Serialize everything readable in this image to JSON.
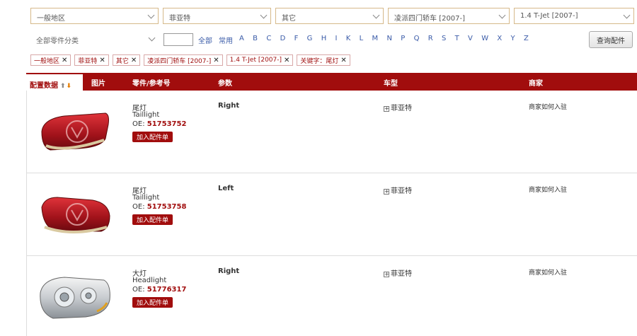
{
  "filters": {
    "region": "一般地区",
    "brand": "菲亚特",
    "series": "其它",
    "model": "凌派四门轿车 [2007-]",
    "engine": "1.4 T-Jet [2007-]"
  },
  "toolbar": {
    "category": "全部零件分类",
    "alpha_input_value": "",
    "alpha_links": [
      "全部",
      "常用",
      "A",
      "B",
      "C",
      "D",
      "F",
      "G",
      "H",
      "I",
      "K",
      "L",
      "M",
      "N",
      "P",
      "Q",
      "R",
      "S",
      "T",
      "V",
      "W",
      "X",
      "Y",
      "Z"
    ],
    "search_label": "查询配件"
  },
  "chips": [
    {
      "label": "一般地区"
    },
    {
      "label": "菲亚特"
    },
    {
      "label": "其它"
    },
    {
      "label": "凌派四门轿车 [2007-]"
    },
    {
      "label": "1.4 T-Jet [2007-]"
    },
    {
      "label": "关键字：尾灯"
    }
  ],
  "table": {
    "tab_active": "配置数据",
    "headers": {
      "image": "图片",
      "part": "零件/参考号",
      "params": "参数",
      "model": "车型",
      "vendor": "商家"
    }
  },
  "items": [
    {
      "name_cn": "尾灯",
      "name_en": "Taillight",
      "oe_prefix": "OE: ",
      "oe": "51753752",
      "add_label": "加入配件单",
      "param": "Right",
      "model": "菲亚特",
      "vendor": "商家如何入驻",
      "thumb_icon": "taillight-image"
    },
    {
      "name_cn": "尾灯",
      "name_en": "Taillight",
      "oe_prefix": "OE: ",
      "oe": "51753758",
      "add_label": "加入配件单",
      "param": "Left",
      "model": "菲亚特",
      "vendor": "商家如何入驻",
      "thumb_icon": "taillight-image"
    },
    {
      "name_cn": "大灯",
      "name_en": "Headlight",
      "oe_prefix": "OE: ",
      "oe": "51776317",
      "add_label": "加入配件单",
      "param": "Right",
      "model": "菲亚特",
      "vendor": "商家如何入驻",
      "thumb_icon": "headlight-image"
    }
  ],
  "colors": {
    "accent": "#a10d0d",
    "link": "#3a5ba8",
    "sort_active": "#e67e00"
  }
}
